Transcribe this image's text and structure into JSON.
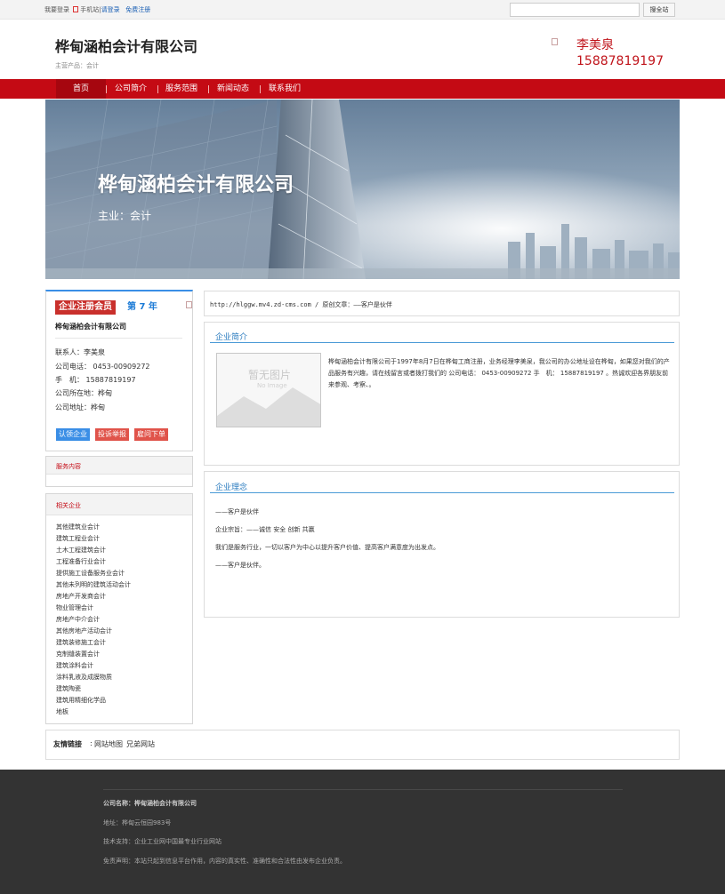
{
  "topbar": {
    "login_prompt": "我要登录",
    "mobile_site": "手机站",
    "login": "请登录",
    "register": "免费注册",
    "search_placeholder": "",
    "search_button": "搜全站"
  },
  "header": {
    "company_name": "桦甸涵柏会计有限公司",
    "main_product": "主营产品：会计",
    "contact_name": "李美泉",
    "contact_phone": "15887819197"
  },
  "nav": {
    "items": [
      {
        "label": "首页"
      },
      {
        "label": "公司简介"
      },
      {
        "label": "服务范围"
      },
      {
        "label": "新闻动态"
      },
      {
        "label": "联系我们"
      }
    ]
  },
  "banner": {
    "title": "桦甸涵柏会计有限公司",
    "subtitle": "主业：会计"
  },
  "card": {
    "badge": "企业注册会员",
    "years": "第 7 年",
    "company": "桦甸涵柏会计有限公司",
    "contact_person": "联系人：李美泉",
    "company_phone": "公司电话： 0453-00909272",
    "mobile": "手　机： 15887819197",
    "location": "公司所在地：桦甸",
    "address": "公司地址：桦甸",
    "btn_claim": "认领企业",
    "btn_report": "投诉举报",
    "btn_order": "雇问下单"
  },
  "service": {
    "title": "服务内容"
  },
  "related": {
    "title": "相关企业",
    "items": [
      "其他建筑业会计",
      "建筑工程业会计",
      "土木工程建筑会计",
      "工程准备行业会计",
      "提供施工设备服务业会计",
      "其他未列明的建筑活动会计",
      "房地产开发商会计",
      "物业管理会计",
      "房地产中介会计",
      "其他房地产活动会计",
      "建筑装修施工会计",
      "克制缝装置会计",
      "建筑涂料会计",
      "涂料乳液及成膜物质",
      "建筑陶瓷",
      "建筑用精细化学品",
      "地板"
    ]
  },
  "breadcrumb": "http://hlggw.mv4.zd-cms.com / 原创文章：——客户是伙伴",
  "intro": {
    "title": "企业简介",
    "no_image": "暂无图片",
    "no_image_sub": "No Image",
    "text": "桦甸涵柏会计有限公司于1997年8月7日在桦甸工商注册，业务经理李美泉，我公司的办公地址设在桦甸，如果您对我们的产品服务有兴趣，请在线留言或者拨打我们的 公司电话： 0453-00909272 手　机： 15887819197 。热诚欢迎各界朋友前来参观、考察、。"
  },
  "philosophy": {
    "title": "企业理念",
    "lines": [
      "——客户是伙伴",
      "企业宗旨：——诚信 安全 创新 共赢",
      "我们是服务行业，一切以客户为中心以提升客户价值、提高客户满意度为出发点。",
      "——客户是伙伴。"
    ]
  },
  "friends": {
    "label": "友情链接",
    "links": [
      "网站地图",
      "兄弟网站"
    ]
  },
  "footer": {
    "company_label": "公司名称：",
    "company": "桦甸涵柏会计有限公司",
    "address": "地址：桦甸云恒园983号",
    "tech": "技术支持：企业工业网中国最专业行业网站",
    "disclaimer": "免责声明：本站只起到信息平台作用，内容的真实性、准确性和合法性由发布企业负责。"
  },
  "colors": {
    "brand_red": "#c40a14",
    "accent_blue": "#2a7bbf",
    "footer_bg": "#333333"
  }
}
